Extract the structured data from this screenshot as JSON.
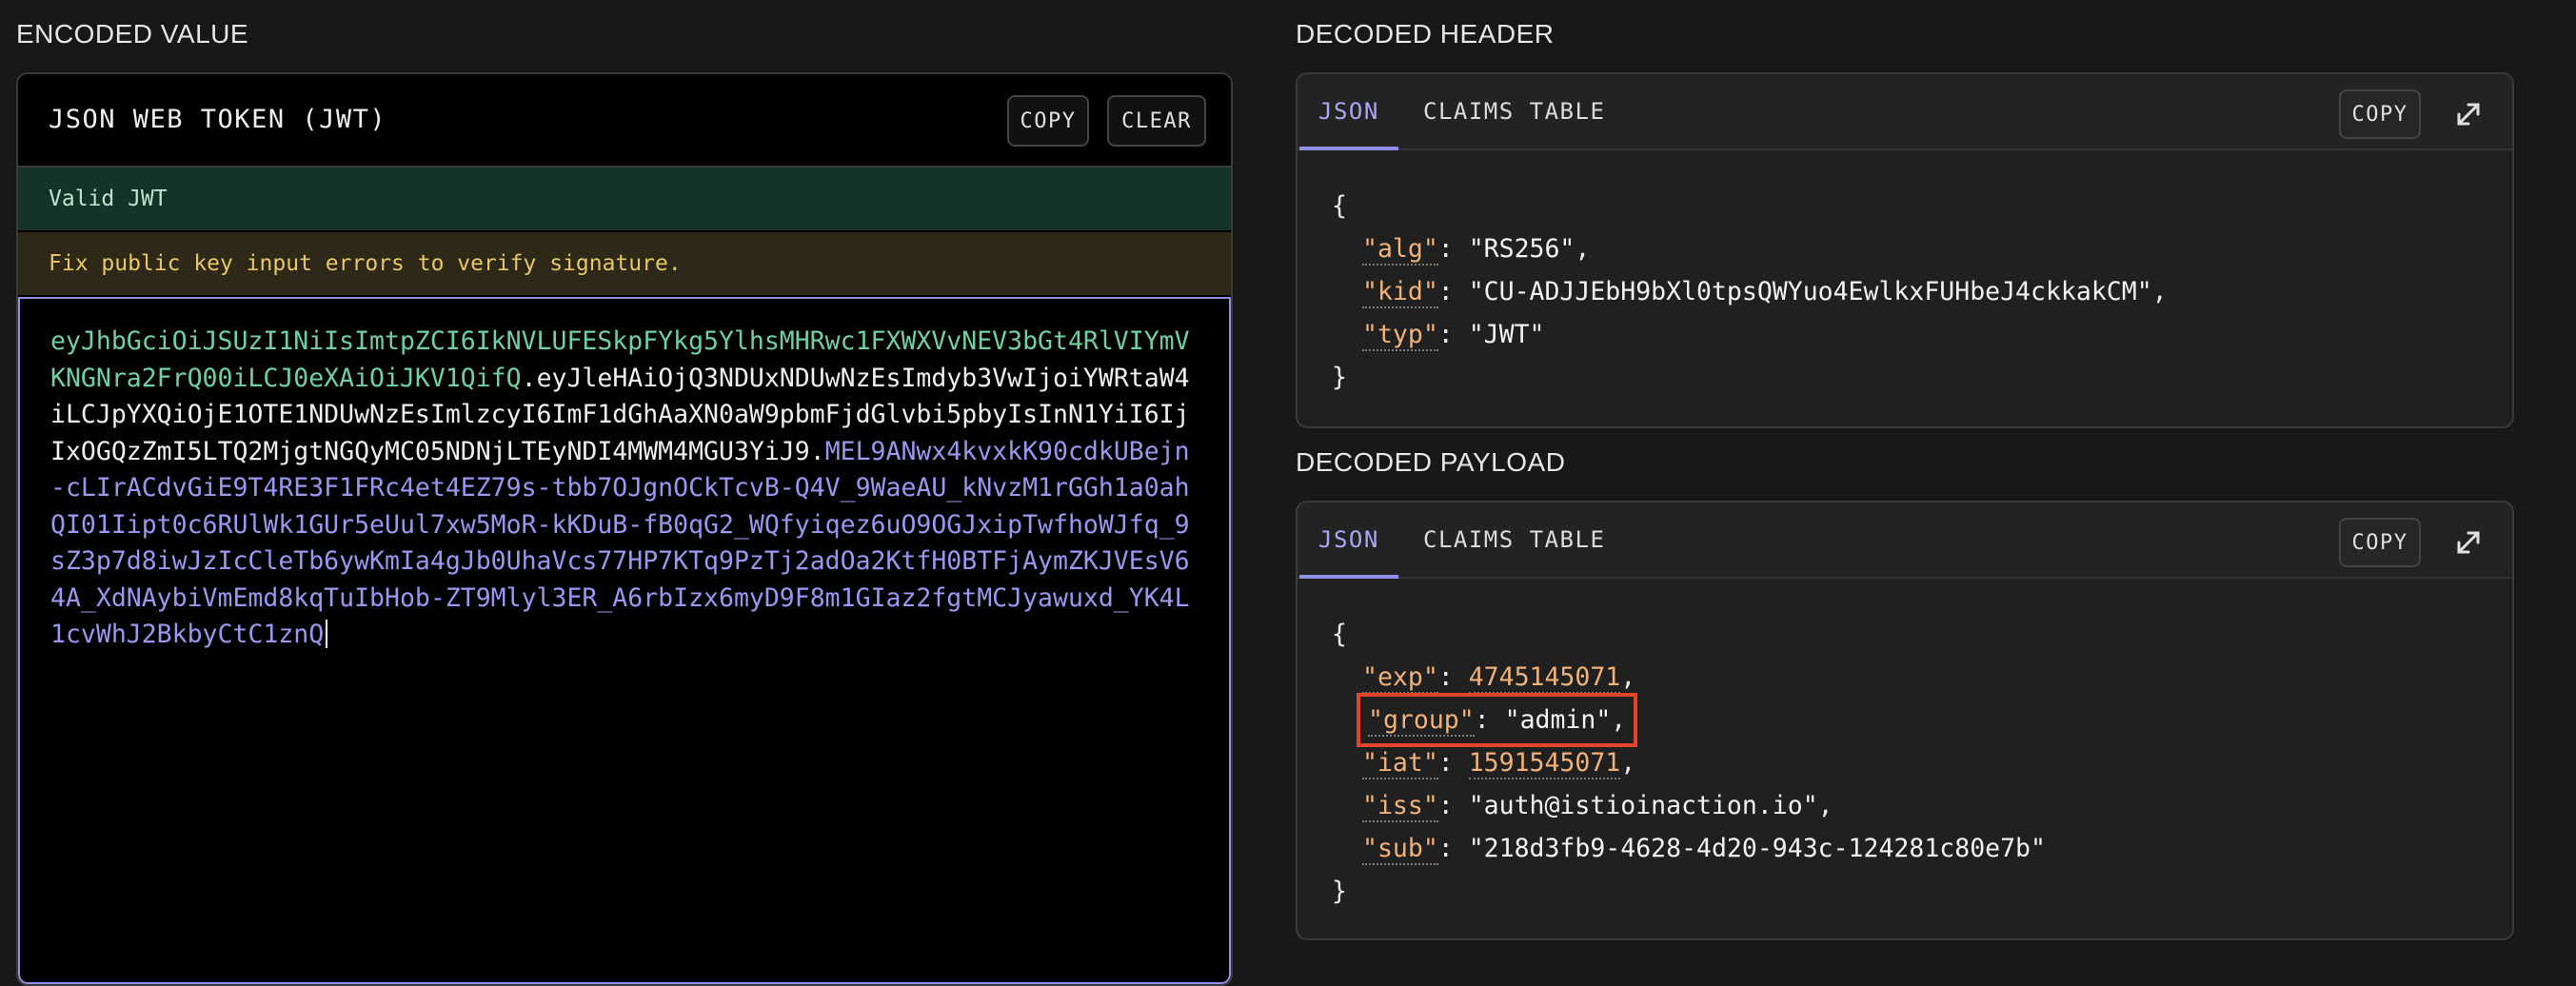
{
  "encoded": {
    "section_title": "ENCODED VALUE",
    "panel_title": "JSON WEB TOKEN (JWT)",
    "copy_label": "COPY",
    "clear_label": "CLEAR",
    "status_valid": "Valid JWT",
    "status_warning": "Fix public key input errors to verify signature.",
    "token_header": "eyJhbGciOiJSUzI1NiIsImtpZCI6IkNVLUFESkpFYkg5YlhsMHRwc1FXWXVvNEV3bGt4RlVIYmVKNGNra2FrQ00iLCJ0eXAiOiJKV1QifQ",
    "token_payload": "eyJleHAiOjQ3NDUxNDUwNzEsImdyb3VwIjoiYWRtaW4iLCJpYXQiOjE1OTE1NDUwNzEsImlzcyI6ImF1dGhAaXN0aW9pbmFjdGlvbi5pbyIsInN1YiI6IjIxOGQzZmI5LTQ2MjgtNGQyMC05NDNjLTEyNDI4MWM4MGU3YiJ9",
    "token_signature": "MEL9ANwx4kvxkK90cdkUBejn-cLIrACdvGiE9T4RE3F1FRc4et4EZ79s-tbb7OJgnOCkTcvB-Q4V_9WaeAU_kNvzM1rGGh1a0ahQI01Iipt0c6RUlWk1GUr5eUul7xw5MoR-kKDuB-fB0qG2_WQfyiqez6uO9OGJxipTwfhoWJfq_9sZ3p7d8iwJzIcCleTb6ywKmIa4gJb0UhaVcs77HP7KTq9PzTj2adOa2KtfH0BTFjAymZKJVEsV64A_XdNAybiVmEmd8kqTuIbHob-ZT9Mlyl3ER_A6rbIzx6myD9F8m1GIaz2fgtMCJyawuxd_YK4L1cvWhJ2BkbyCtC1znQ"
  },
  "decoded_header": {
    "section_title": "DECODED HEADER",
    "tab_json": "JSON",
    "tab_claims": "CLAIMS TABLE",
    "copy_label": "COPY",
    "fields": [
      {
        "key": "alg",
        "value": "\"RS256\""
      },
      {
        "key": "kid",
        "value": "\"CU-ADJJEbH9bXl0tpsQWYuo4EwlkxFUHbeJ4ckkakCM\""
      },
      {
        "key": "typ",
        "value": "\"JWT\""
      }
    ]
  },
  "decoded_payload": {
    "section_title": "DECODED PAYLOAD",
    "tab_json": "JSON",
    "tab_claims": "CLAIMS TABLE",
    "copy_label": "COPY",
    "fields": [
      {
        "key": "exp",
        "value": "4745145071"
      },
      {
        "key": "group",
        "value": "\"admin\""
      },
      {
        "key": "iat",
        "value": "1591545071"
      },
      {
        "key": "iss",
        "value": "\"auth@istioinaction.io\""
      },
      {
        "key": "sub",
        "value": "\"218d3fb9-4628-4d20-943c-124281c80e7b\""
      }
    ]
  },
  "colors": {
    "accent": "#8f8fe8",
    "token_header": "#6fd0a1",
    "token_signature": "#9b97f0",
    "highlight": "#e2442e",
    "valid_bg": "#16332a",
    "warn_bg": "#2e2818"
  },
  "icons": {
    "expand": "expand-icon"
  }
}
